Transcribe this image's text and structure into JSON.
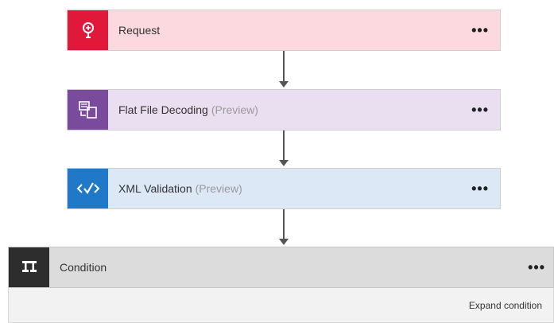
{
  "steps": [
    {
      "label": "Request",
      "suffix": "",
      "icon": "request-icon",
      "color": "#e0193b"
    },
    {
      "label": "Flat File Decoding",
      "suffix": "(Preview)",
      "icon": "flat-file-icon",
      "color": "#7a4b9c"
    },
    {
      "label": "XML Validation",
      "suffix": "(Preview)",
      "icon": "xml-validation-icon",
      "color": "#1f78c8"
    }
  ],
  "more_glyph": "•••",
  "condition": {
    "label": "Condition",
    "icon": "condition-icon",
    "expand_label": "Expand condition"
  }
}
